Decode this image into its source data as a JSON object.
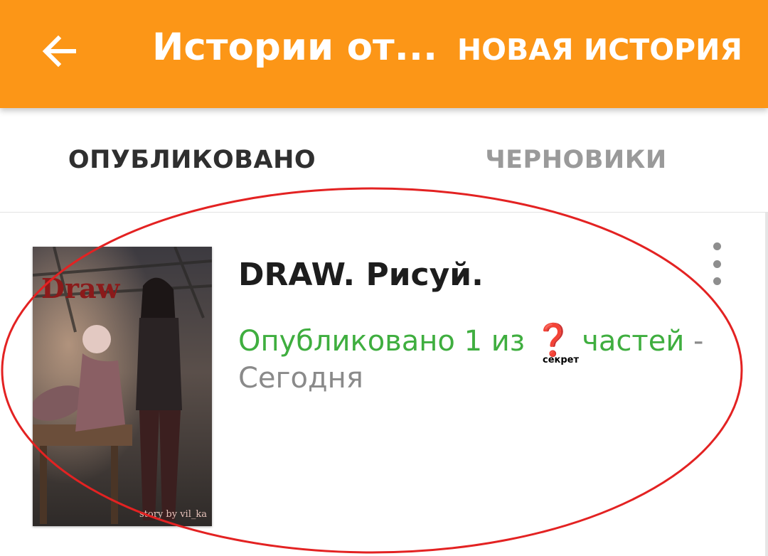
{
  "app_bar": {
    "title": "Истории от...",
    "action_label": "НОВАЯ ИСТОРИЯ",
    "back_icon": "arrow-left-icon",
    "background_color": "#fc9617"
  },
  "tabs": {
    "items": [
      {
        "label": "ОПУБЛИКОВАНО",
        "selected": true
      },
      {
        "label": "ЧЕРНОВИКИ",
        "selected": false
      }
    ],
    "indicator_color": "#0f9ab0"
  },
  "story": {
    "title": "DRAW. Рисуй.",
    "status_prefix": "Опубликовано 1 из",
    "status_hidden_count": "❓",
    "status_suffix": "частей",
    "separator": "-",
    "updated": "Сегодня",
    "annotation": "секрет",
    "cover": {
      "title_text": "Draw",
      "credit_text": "story by vil_ka"
    },
    "menu_icon": "more-vertical-icon"
  },
  "colors": {
    "status_green": "#3fae3f",
    "annotation_red": "#e0201e"
  }
}
